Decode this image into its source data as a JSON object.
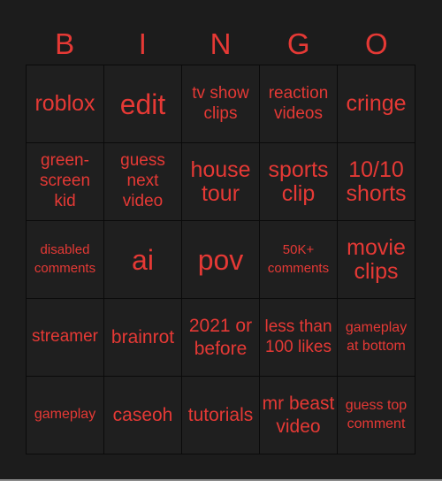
{
  "header": {
    "letters": [
      "B",
      "I",
      "N",
      "G",
      "O"
    ]
  },
  "board": {
    "text_color": "#e53935",
    "cells": [
      [
        "roblox",
        "edit",
        "tv show clips",
        "reaction videos",
        "cringe"
      ],
      [
        "green-screen kid",
        "guess next video",
        "house tour",
        "sports clip",
        "10/10 shorts"
      ],
      [
        "disabled comments",
        "ai",
        "pov",
        "50K+ comments",
        "movie clips"
      ],
      [
        "streamer",
        "brainrot",
        "2021 or before",
        "less than 100 likes",
        "gameplay at bottom"
      ],
      [
        "gameplay",
        "caseoh",
        "tutorials",
        "mr beast video",
        "guess top comment"
      ]
    ]
  }
}
